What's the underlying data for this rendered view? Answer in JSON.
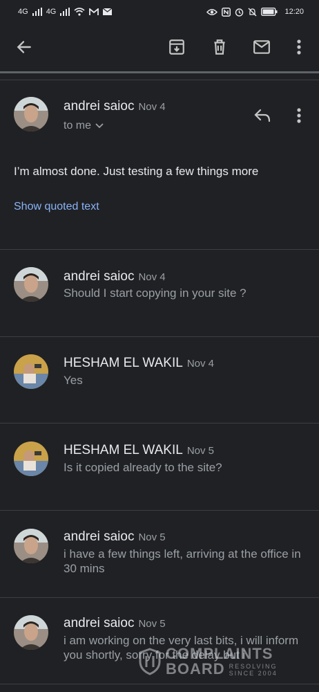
{
  "status_bar": {
    "net_left": "4G",
    "net_right": "4G",
    "time": "12:20"
  },
  "toolbar": {
    "icons": [
      "back-arrow-icon",
      "archive-icon",
      "delete-icon",
      "mark-unread-icon",
      "more-vert-icon"
    ]
  },
  "open_message": {
    "sender": "andrei saioc",
    "date": "Nov 4",
    "to_label": "to me",
    "body": "I’m almost done. Just testing a few things more",
    "quoted_link": "Show quoted text"
  },
  "messages": [
    {
      "sender": "andrei saioc",
      "date": "Nov 4",
      "snippet": "Should I start copying in your site ?"
    },
    {
      "sender": "HESHAM EL WAKIL",
      "date": "Nov 4",
      "snippet": "Yes"
    },
    {
      "sender": "HESHAM EL WAKIL",
      "date": "Nov 5",
      "snippet": "Is it copied already to the site?"
    },
    {
      "sender": "andrei saioc",
      "date": "Nov 5",
      "snippet": "i have a few things left, arriving at the office in 30 mins"
    },
    {
      "sender": "andrei saioc",
      "date": "Nov 5",
      "snippet": "i am working on the very last bits, i will inform you shortly, sorry for the delay but i"
    }
  ],
  "watermark": {
    "line1": "COMPLAINTS",
    "line2": "BOARD",
    "tagline1": "RESOLVING",
    "tagline2": "SINCE 2004"
  }
}
